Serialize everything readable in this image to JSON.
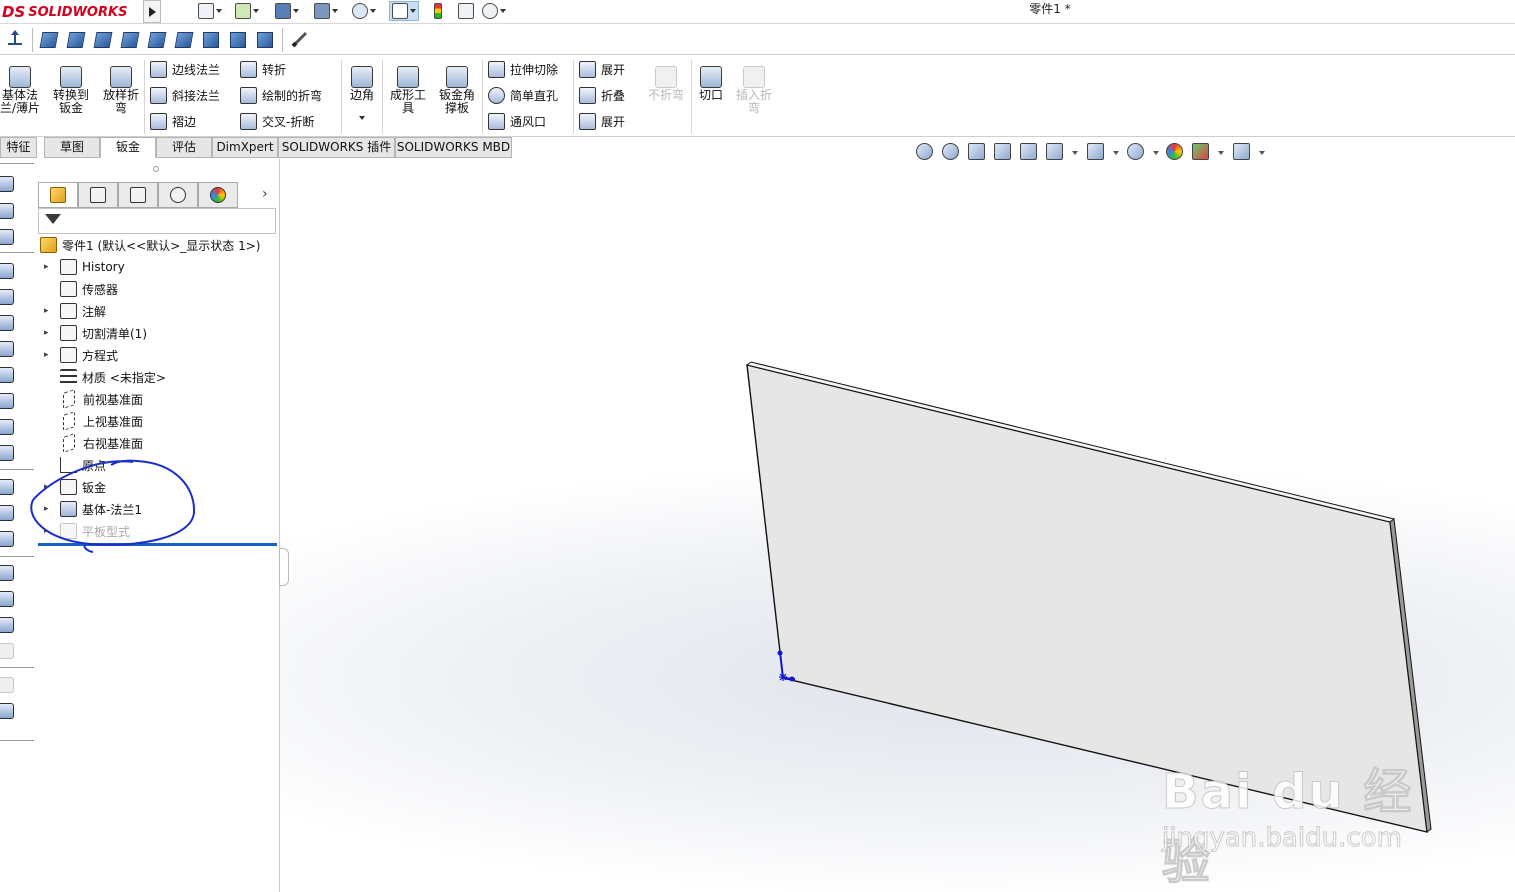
{
  "app": {
    "logo_ds": "DS",
    "logo_name": "SOLIDWORKS",
    "document_title": "零件1 *"
  },
  "ribbon": {
    "big_buttons": [
      {
        "label": "基体法兰/薄片",
        "enabled": true
      },
      {
        "label": "转换到钣金",
        "enabled": true
      },
      {
        "label": "放样折弯",
        "enabled": true
      },
      {
        "label": "边角",
        "enabled": true
      },
      {
        "label": "成形工具",
        "enabled": true
      },
      {
        "label": "钣金角撑板",
        "enabled": true
      },
      {
        "label": "不折弯",
        "enabled": false
      },
      {
        "label": "切口",
        "enabled": true
      },
      {
        "label": "插入折弯",
        "enabled": false
      }
    ],
    "group1": [
      "边线法兰",
      "斜接法兰",
      "褶边"
    ],
    "group2": [
      "转折",
      "绘制的折弯",
      "交叉-折断"
    ],
    "group3": [
      "拉伸切除",
      "简单直孔",
      "通风口"
    ],
    "group4": [
      "展开",
      "折叠",
      "展开"
    ]
  },
  "tabs": [
    {
      "label": "特征",
      "active": false
    },
    {
      "label": "草图",
      "active": false
    },
    {
      "label": "钣金",
      "active": true
    },
    {
      "label": "评估",
      "active": false
    },
    {
      "label": "DimXpert",
      "active": false
    },
    {
      "label": "SOLIDWORKS 插件",
      "active": false
    },
    {
      "label": "SOLIDWORKS MBD",
      "active": false
    }
  ],
  "feature_tree": {
    "root": "零件1  (默认<<默认>_显示状态 1>)",
    "items": [
      {
        "label": "History",
        "expandable": true,
        "dimmed": false,
        "icon": "history-folder-icon"
      },
      {
        "label": "传感器",
        "expandable": false,
        "dimmed": false,
        "icon": "sensor-folder-icon"
      },
      {
        "label": "注解",
        "expandable": true,
        "dimmed": false,
        "icon": "annotation-icon"
      },
      {
        "label": "切割清单(1)",
        "expandable": true,
        "dimmed": false,
        "icon": "cut-list-icon"
      },
      {
        "label": "方程式",
        "expandable": true,
        "dimmed": false,
        "icon": "equation-icon"
      },
      {
        "label": "材质 <未指定>",
        "expandable": false,
        "dimmed": false,
        "icon": "material-icon"
      },
      {
        "label": "前视基准面",
        "expandable": false,
        "dimmed": false,
        "icon": "plane-icon"
      },
      {
        "label": "上视基准面",
        "expandable": false,
        "dimmed": false,
        "icon": "plane-icon"
      },
      {
        "label": "右视基准面",
        "expandable": false,
        "dimmed": false,
        "icon": "plane-icon"
      },
      {
        "label": "原点",
        "expandable": false,
        "dimmed": false,
        "icon": "origin-icon"
      },
      {
        "label": "钣金",
        "expandable": true,
        "dimmed": false,
        "icon": "sheet-metal-icon"
      },
      {
        "label": "基体-法兰1",
        "expandable": true,
        "dimmed": false,
        "icon": "base-flange-icon"
      },
      {
        "label": "平板型式",
        "expandable": true,
        "dimmed": true,
        "icon": "flat-pattern-icon"
      }
    ]
  },
  "watermark": {
    "brand": "Bai du 经验",
    "url": "jingyan.baidu.com"
  },
  "colors": {
    "logo_red": "#d5001f",
    "annotation_blue": "#1a2ec8",
    "rollback_blue": "#1463c8",
    "part_face": "#e6e6e6"
  }
}
